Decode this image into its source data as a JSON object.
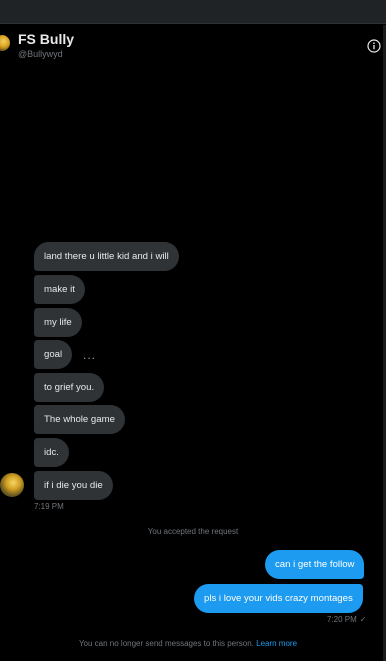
{
  "conversation": {
    "name": "FS Bully",
    "handle": "@Bullywyd"
  },
  "messages": {
    "incoming": [
      "land there u little kid and i will",
      "make it",
      "my life",
      "goal",
      "to grief you.",
      "The whole game",
      "idc.",
      "if i die you die"
    ],
    "incoming_time": "7:19 PM",
    "typing_dots": "...",
    "system_notice": "You accepted the request",
    "outgoing": [
      "can i get the follow",
      "pls i love your vids crazy montages"
    ],
    "outgoing_time": "7:20 PM",
    "outgoing_check": "✓"
  },
  "footer": {
    "text": "You can no longer send messages to this person.",
    "link": "Learn more"
  },
  "colors": {
    "background": "#000000",
    "incoming_bubble": "#2f3336",
    "outgoing_bubble": "#1d9bf0",
    "muted_text": "#71767b"
  },
  "icons": {
    "info": "info-icon"
  }
}
